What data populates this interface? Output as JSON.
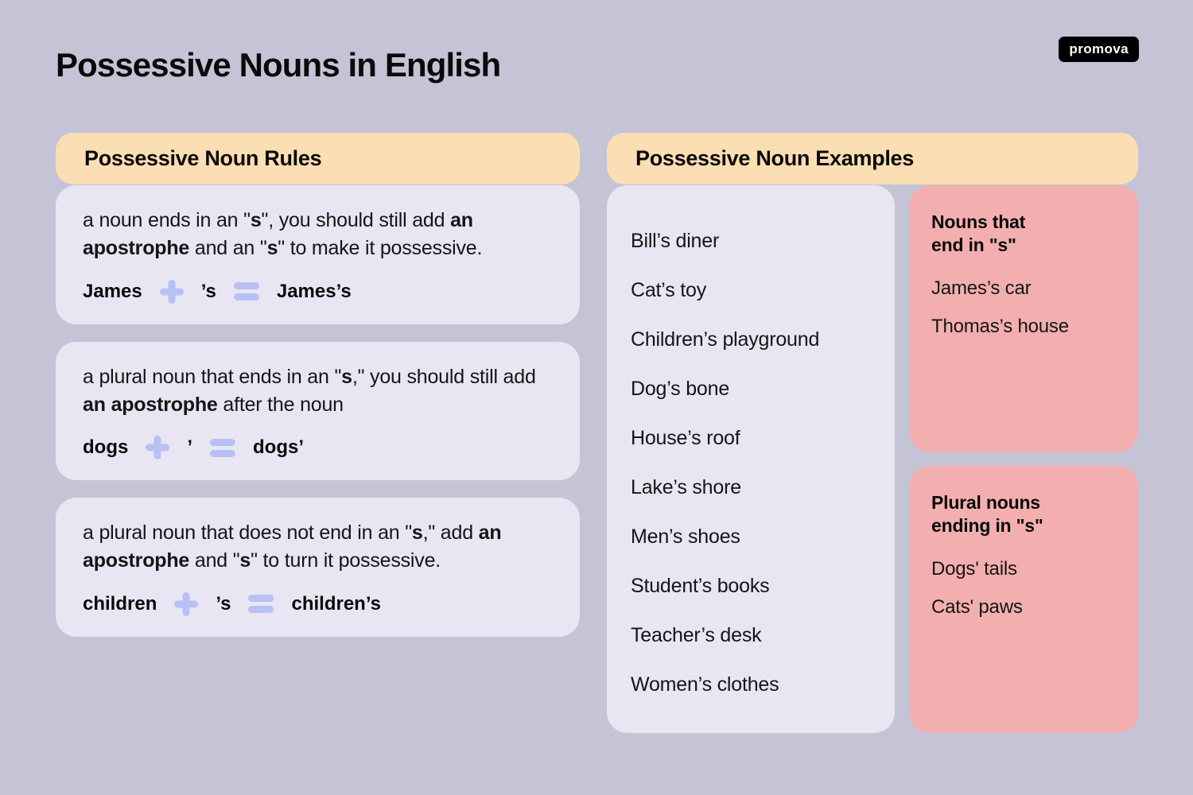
{
  "page": {
    "title": "Possessive Nouns in English",
    "background_color": "#c5c3d6",
    "logo_text": "promova"
  },
  "rules_section": {
    "header": "Possessive Noun Rules",
    "header_color": "#fbdeb3",
    "card_color": "#e7e6f2",
    "operator_color": "#b9c0f5",
    "cards": [
      {
        "text_parts": [
          {
            "text": "a noun ends in an \"",
            "bold": false
          },
          {
            "text": "s",
            "bold": true
          },
          {
            "text": "\", you should still add ",
            "bold": false
          },
          {
            "text": "an apostrophe",
            "bold": true
          },
          {
            "text": " and an \"",
            "bold": false
          },
          {
            "text": "s",
            "bold": true
          },
          {
            "text": "\" to make it possessive.",
            "bold": false
          }
        ],
        "formula": {
          "base": "James",
          "plus": "+",
          "suffix": "’s",
          "equals": "=",
          "result": "James’s"
        }
      },
      {
        "text_parts": [
          {
            "text": "a plural noun that ends in an \"",
            "bold": false
          },
          {
            "text": "s",
            "bold": true
          },
          {
            "text": ",\" you should still add ",
            "bold": false
          },
          {
            "text": "an apostrophe",
            "bold": true
          },
          {
            "text": " after the noun",
            "bold": false
          }
        ],
        "formula": {
          "base": "dogs",
          "plus": "+",
          "suffix": "’",
          "equals": "=",
          "result": "dogs’"
        }
      },
      {
        "text_parts": [
          {
            "text": "a plural noun that does not end in an \"",
            "bold": false
          },
          {
            "text": "s",
            "bold": true
          },
          {
            "text": ",\" add ",
            "bold": false
          },
          {
            "text": "an apostrophe",
            "bold": true
          },
          {
            "text": " and \"",
            "bold": false
          },
          {
            "text": "s",
            "bold": true
          },
          {
            "text": "\" to turn it possessive.",
            "bold": false
          }
        ],
        "formula": {
          "base": "children",
          "plus": "+",
          "suffix": "’s",
          "equals": "=",
          "result": "children’s"
        }
      }
    ]
  },
  "examples_section": {
    "header": "Possessive Noun Examples",
    "header_color": "#fbdeb3",
    "list_card_color": "#e7e6f2",
    "highlight_card_color": "#f3afaf",
    "items": [
      "Bill’s diner",
      "Cat’s toy",
      "Children’s playground",
      "Dog’s bone",
      "House’s roof",
      "Lake’s shore",
      "Men’s shoes",
      "Student’s books",
      "Teacher’s desk",
      "Women’s clothes"
    ],
    "highlight_cards": [
      {
        "title": "Nouns that\nend in \"s\"",
        "items": [
          "James’s car",
          "Thomas’s house"
        ]
      },
      {
        "title": "Plural nouns\nending in \"s\"",
        "items": [
          "Dogs' tails",
          "Cats' paws"
        ]
      }
    ]
  }
}
